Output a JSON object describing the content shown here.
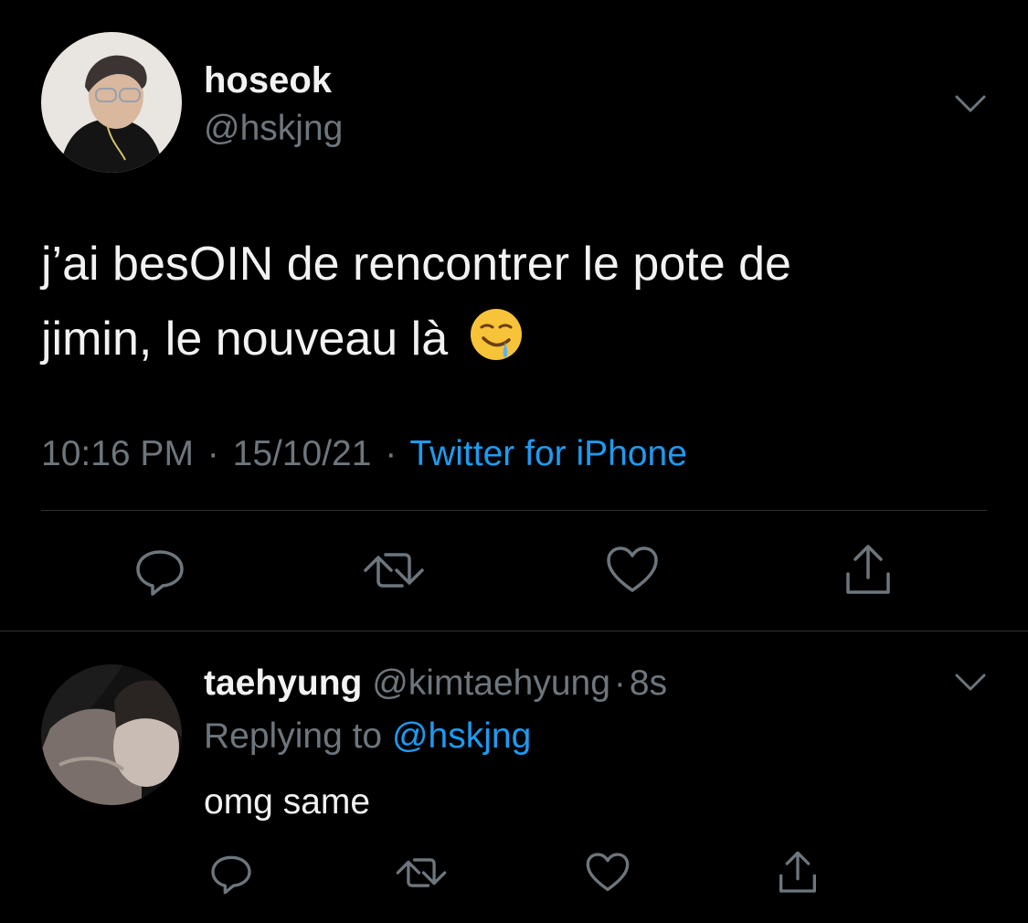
{
  "tweet": {
    "display_name": "hoseok",
    "handle": "@hskjng",
    "text_line1": "j’ai besOIN de rencontrer le pote de",
    "text_line2": "jimin, le nouveau là",
    "emoji": "🤤",
    "time": "10:16 PM",
    "sep1": "·",
    "date": "15/10/21",
    "sep2": "·",
    "source": "Twitter for iPhone",
    "actions": [
      "reply-icon",
      "retweet-icon",
      "like-icon",
      "share-icon"
    ]
  },
  "reply": {
    "display_name": "taehyung",
    "handle": "@kimtaehyung",
    "sep": "·",
    "age": "8s",
    "replying_prefix": "Replying to",
    "replying_handle": "@hskjng",
    "text": "omg same",
    "actions": [
      "reply-icon",
      "retweet-icon",
      "like-icon",
      "share-icon"
    ]
  },
  "colors": {
    "background": "#000000",
    "text": "#d9d9d9",
    "muted": "#6e767d",
    "link": "#1d9bf0",
    "divider": "#2f3336"
  }
}
